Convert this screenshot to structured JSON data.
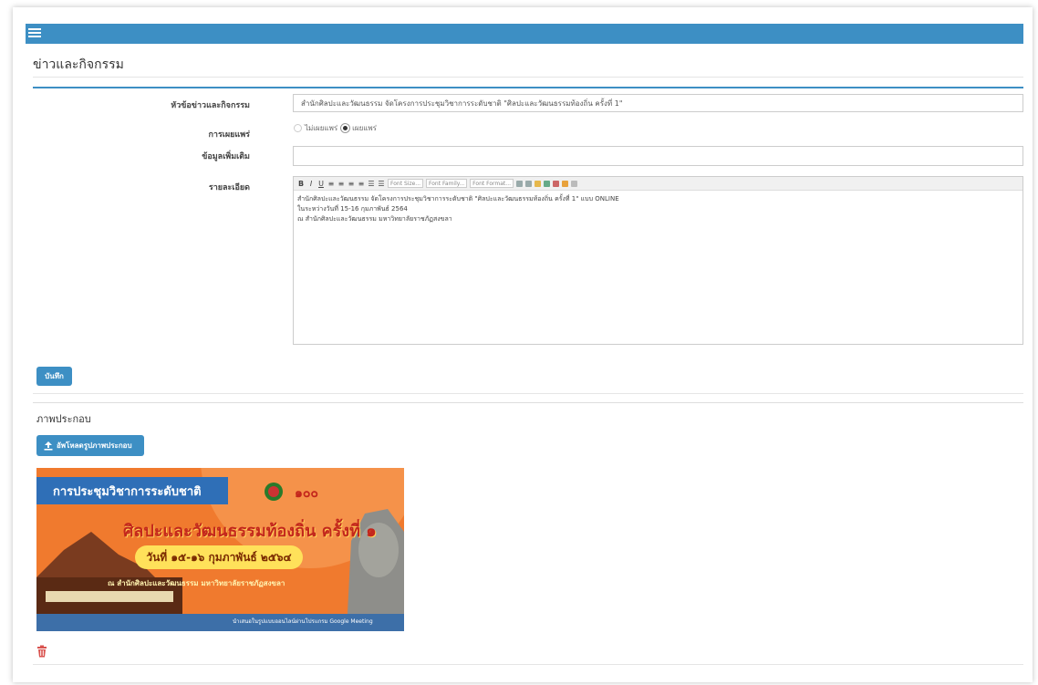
{
  "page": {
    "title": "ข่าวและกิจกรรม"
  },
  "form": {
    "headline_label": "หัวข้อข่าวและกิจกรรม",
    "headline_value": "สำนักศิลปะและวัฒนธรรม จัดโครงการประชุมวิชาการระดับชาติ \"ศิลปะและวัฒนธรรมท้องถิ่น ครั้งที่ 1\"",
    "publish_label": "การเผยแพร่",
    "publish_options": [
      "ไม่เผยแพร่",
      "เผยแพร่"
    ],
    "publish_selected": "เผยแพร่",
    "extra_label": "ข้อมูลเพิ่มเติม",
    "extra_value": "",
    "detail_label": "รายละเอียด",
    "editor_toolbar": {
      "bold": "B",
      "italic": "I",
      "underline": "U",
      "font_size": "Font Size...",
      "font_family": "Font Family...",
      "font_format": "Font Format..."
    },
    "detail_lines": [
      "สำนักศิลปะและวัฒนธรรม จัดโครงการประชุมวิชาการระดับชาติ \"ศิลปะและวัฒนธรรมท้องถิ่น ครั้งที่ 1\" แบบ ONLINE",
      "ในระหว่างวันที่ 15-16 กุมภาพันธ์ 2564",
      "ณ สำนักศิลปะและวัฒนธรรม มหาวิทยาลัยราชภัฏสงขลา"
    ],
    "save_label": "บันทึก"
  },
  "images": {
    "section_title": "ภาพประกอบ",
    "upload_label": "อัพโหลดรูปภาพประกอบ",
    "banner": {
      "title": "การประชุมวิชาการระดับชาติ",
      "heading": "ศิลปะและวัฒนธรรมท้องถิ่น ครั้งที่ ๑",
      "date": "วันที่ ๑๕-๑๖ กุมภาพันธ์ ๒๕๖๔",
      "org": "ณ สำนักศิลปะและวัฒนธรรม มหาวิทยาลัยราชภัฏสงขลา",
      "footer": "นำเสนอในรูปแบบออนไลน์ผ่านโปรแกรม Google Meeting"
    }
  },
  "colors": {
    "primary": "#3d8fc4",
    "banner_orange": "#f07a2e",
    "banner_blue": "#2f6fb7",
    "danger": "#d9534f"
  }
}
